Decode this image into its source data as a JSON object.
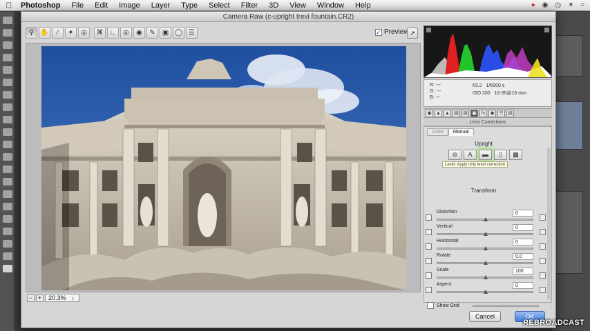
{
  "menubar": {
    "app": "Photoshop",
    "items": [
      "File",
      "Edit",
      "Image",
      "Layer",
      "Type",
      "Select",
      "Filter",
      "3D",
      "View",
      "Window",
      "Help"
    ]
  },
  "dialog": {
    "title": "Camera Raw (c-upright trevi fountain.CR2)",
    "preview_label": "Preview",
    "preview_checked": true,
    "zoom": "20.3%"
  },
  "toolbar": {
    "tools": [
      "zoom-icon",
      "hand-icon",
      "white-balance-icon",
      "color-sampler-icon",
      "targeted-adjust-icon",
      "crop-icon",
      "straighten-icon",
      "spot-removal-icon",
      "red-eye-icon",
      "adjustment-brush-icon",
      "graduated-filter-icon",
      "radial-filter-icon",
      "preferences-icon"
    ]
  },
  "info": {
    "r_label": "R:",
    "g_label": "G:",
    "b_label": "B:",
    "r": "---",
    "g": "---",
    "b": "---",
    "aperture": "f/3.2",
    "shutter": "1/5000 s",
    "iso": "ISO 200",
    "lens": "16-35@16 mm"
  },
  "panel": {
    "title": "Lens Corrections",
    "subtab_color": "Color",
    "subtab_manual": "Manual",
    "upright_label": "Upright",
    "tooltip": "Level: Apply only level correction",
    "transform_label": "Transform",
    "sliders": [
      {
        "label": "Distortion",
        "value": "0",
        "pos": 0.5
      },
      {
        "label": "Vertical",
        "value": "0",
        "pos": 0.5
      },
      {
        "label": "Horizontal",
        "value": "0",
        "pos": 0.5
      },
      {
        "label": "Rotate",
        "value": "0.0",
        "pos": 0.5
      },
      {
        "label": "Scale",
        "value": "100",
        "pos": 0.5
      },
      {
        "label": "Aspect",
        "value": "0",
        "pos": 0.5
      }
    ],
    "show_grid_label": "Show Grid"
  },
  "buttons": {
    "cancel": "Cancel",
    "ok": "OK"
  },
  "watermark": "REBROADCAST",
  "colors": {
    "ok_blue": "#3d7de2",
    "sky": "#2d5fb8"
  }
}
